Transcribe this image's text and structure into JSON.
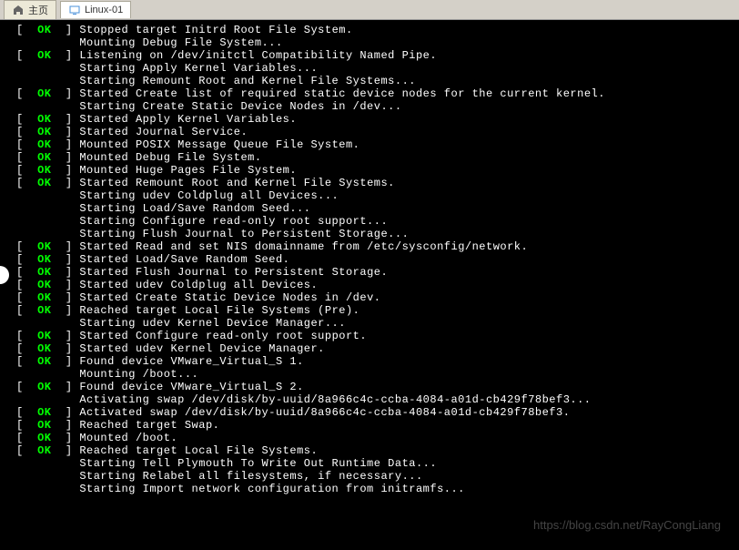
{
  "tabs": {
    "home": "主页",
    "linux": "Linux-01"
  },
  "lines": [
    {
      "status": "OK",
      "text": "Stopped target Initrd Root File System."
    },
    {
      "status": null,
      "text": "Mounting Debug File System..."
    },
    {
      "status": "OK",
      "text": "Listening on /dev/initctl Compatibility Named Pipe."
    },
    {
      "status": null,
      "text": "Starting Apply Kernel Variables..."
    },
    {
      "status": null,
      "text": "Starting Remount Root and Kernel File Systems..."
    },
    {
      "status": "OK",
      "text": "Started Create list of required static device nodes for the current kernel."
    },
    {
      "status": null,
      "text": "Starting Create Static Device Nodes in /dev..."
    },
    {
      "status": "OK",
      "text": "Started Apply Kernel Variables."
    },
    {
      "status": "OK",
      "text": "Started Journal Service."
    },
    {
      "status": "OK",
      "text": "Mounted POSIX Message Queue File System."
    },
    {
      "status": "OK",
      "text": "Mounted Debug File System."
    },
    {
      "status": "OK",
      "text": "Mounted Huge Pages File System."
    },
    {
      "status": "OK",
      "text": "Started Remount Root and Kernel File Systems."
    },
    {
      "status": null,
      "text": "Starting udev Coldplug all Devices..."
    },
    {
      "status": null,
      "text": "Starting Load/Save Random Seed..."
    },
    {
      "status": null,
      "text": "Starting Configure read-only root support..."
    },
    {
      "status": null,
      "text": "Starting Flush Journal to Persistent Storage..."
    },
    {
      "status": "OK",
      "text": "Started Read and set NIS domainname from /etc/sysconfig/network."
    },
    {
      "status": "OK",
      "text": "Started Load/Save Random Seed."
    },
    {
      "status": "OK",
      "text": "Started Flush Journal to Persistent Storage."
    },
    {
      "status": "OK",
      "text": "Started udev Coldplug all Devices."
    },
    {
      "status": "OK",
      "text": "Started Create Static Device Nodes in /dev."
    },
    {
      "status": "OK",
      "text": "Reached target Local File Systems (Pre)."
    },
    {
      "status": null,
      "text": "Starting udev Kernel Device Manager..."
    },
    {
      "status": "OK",
      "text": "Started Configure read-only root support."
    },
    {
      "status": "OK",
      "text": "Started udev Kernel Device Manager."
    },
    {
      "status": "OK",
      "text": "Found device VMware_Virtual_S 1."
    },
    {
      "status": null,
      "text": "Mounting /boot..."
    },
    {
      "status": "OK",
      "text": "Found device VMware_Virtual_S 2."
    },
    {
      "status": null,
      "text": "Activating swap /dev/disk/by-uuid/8a966c4c-ccba-4084-a01d-cb429f78bef3..."
    },
    {
      "status": "OK",
      "text": "Activated swap /dev/disk/by-uuid/8a966c4c-ccba-4084-a01d-cb429f78bef3."
    },
    {
      "status": "OK",
      "text": "Reached target Swap."
    },
    {
      "status": "OK",
      "text": "Mounted /boot."
    },
    {
      "status": "OK",
      "text": "Reached target Local File Systems."
    },
    {
      "status": null,
      "text": "Starting Tell Plymouth To Write Out Runtime Data..."
    },
    {
      "status": null,
      "text": "Starting Relabel all filesystems, if necessary..."
    },
    {
      "status": null,
      "text": "Starting Import network configuration from initramfs..."
    }
  ],
  "watermark": "https://blog.csdn.net/RayCongLiang"
}
